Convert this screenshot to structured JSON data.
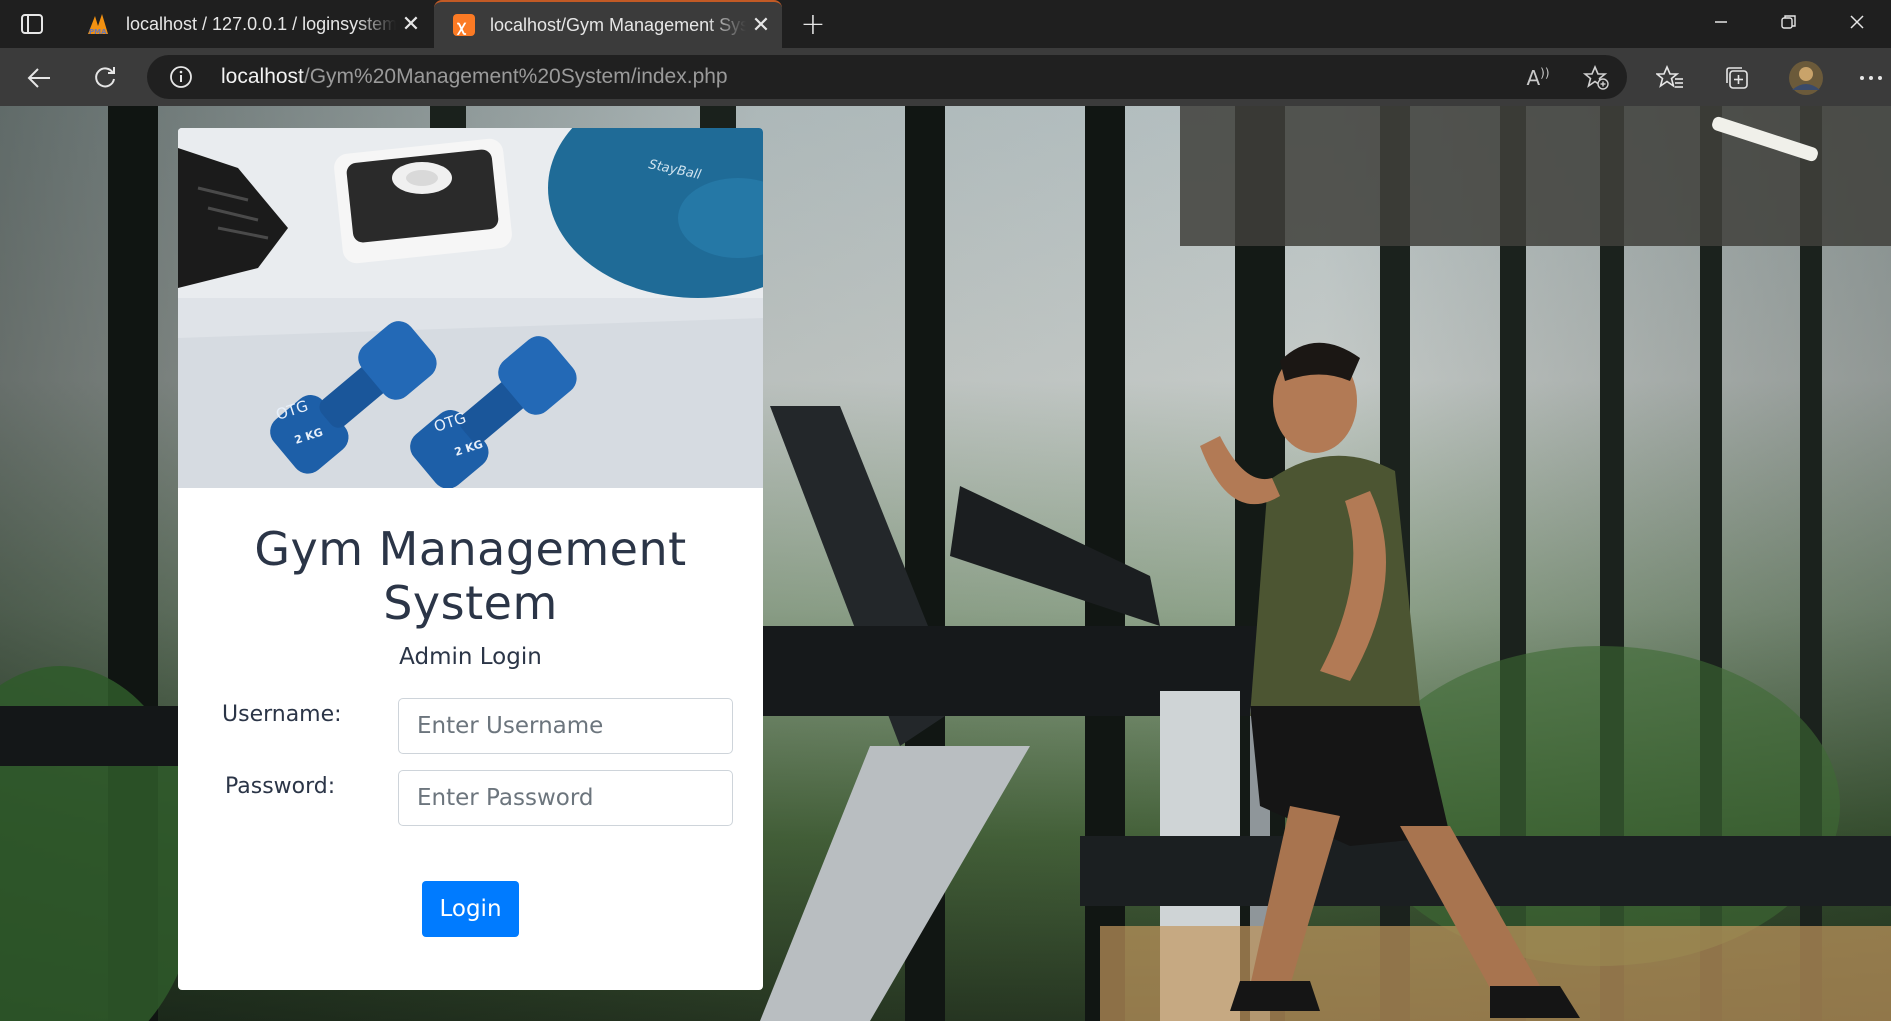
{
  "browser": {
    "tabs": [
      {
        "title": "localhost / 127.0.0.1 / loginsystem",
        "favicon": "phpmyadmin-icon",
        "active": false
      },
      {
        "title": "localhost/Gym Management System",
        "favicon": "xampp-icon",
        "active": true
      }
    ],
    "address": {
      "host": "localhost",
      "path": "/Gym%20Management%20System/index.php"
    }
  },
  "login_card": {
    "title_line1": "Gym Management",
    "title_line2": "System",
    "subtitle": "Admin Login",
    "username_label": "Username:",
    "username_placeholder": "Enter Username",
    "password_label": "Password:",
    "password_placeholder": "Enter Password",
    "login_button": "Login"
  },
  "colors": {
    "primary_button": "#007bff",
    "card_bg": "#ffffff",
    "title_text": "#2b3547",
    "browser_dark": "#1f1f1f",
    "active_tab_accent": "#c25a25"
  }
}
